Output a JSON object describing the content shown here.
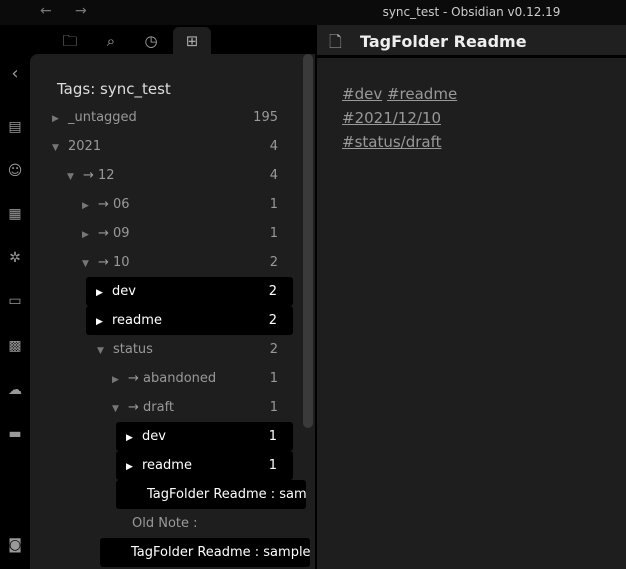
{
  "window": {
    "title": "sync_test - Obsidian v0.12.19",
    "back": "←",
    "forward": "→"
  },
  "sidebar": {
    "title": "Tags: sync_test",
    "rows": [
      {
        "label": "_untagged",
        "count": "195",
        "arrow": "▶"
      },
      {
        "label": "2021",
        "count": "4",
        "arrow": "▼"
      },
      {
        "label": "→ 12",
        "count": "4",
        "arrow": "▼"
      },
      {
        "label": "→ 06",
        "count": "1",
        "arrow": "▶"
      },
      {
        "label": "→ 09",
        "count": "1",
        "arrow": "▶"
      },
      {
        "label": "→ 10",
        "count": "2",
        "arrow": "▼"
      },
      {
        "label": "dev",
        "count": "2",
        "arrow": "▶"
      },
      {
        "label": "readme",
        "count": "2",
        "arrow": "▶"
      },
      {
        "label": "status",
        "count": "2",
        "arrow": "▼"
      },
      {
        "label": "→ abandoned",
        "count": "1",
        "arrow": "▶"
      },
      {
        "label": "→ draft",
        "count": "1",
        "arrow": "▼"
      },
      {
        "label": "dev",
        "count": "1",
        "arrow": "▶"
      },
      {
        "label": "readme",
        "count": "1",
        "arrow": "▶"
      },
      {
        "label": "TagFolder Readme : sample"
      },
      {
        "label": "Old Note :"
      },
      {
        "label": "TagFolder Readme : sample"
      }
    ]
  },
  "editor": {
    "title": "TagFolder Readme",
    "tags": [
      "#dev",
      "#readme",
      "#2021/12/10",
      "#status/draft"
    ]
  }
}
